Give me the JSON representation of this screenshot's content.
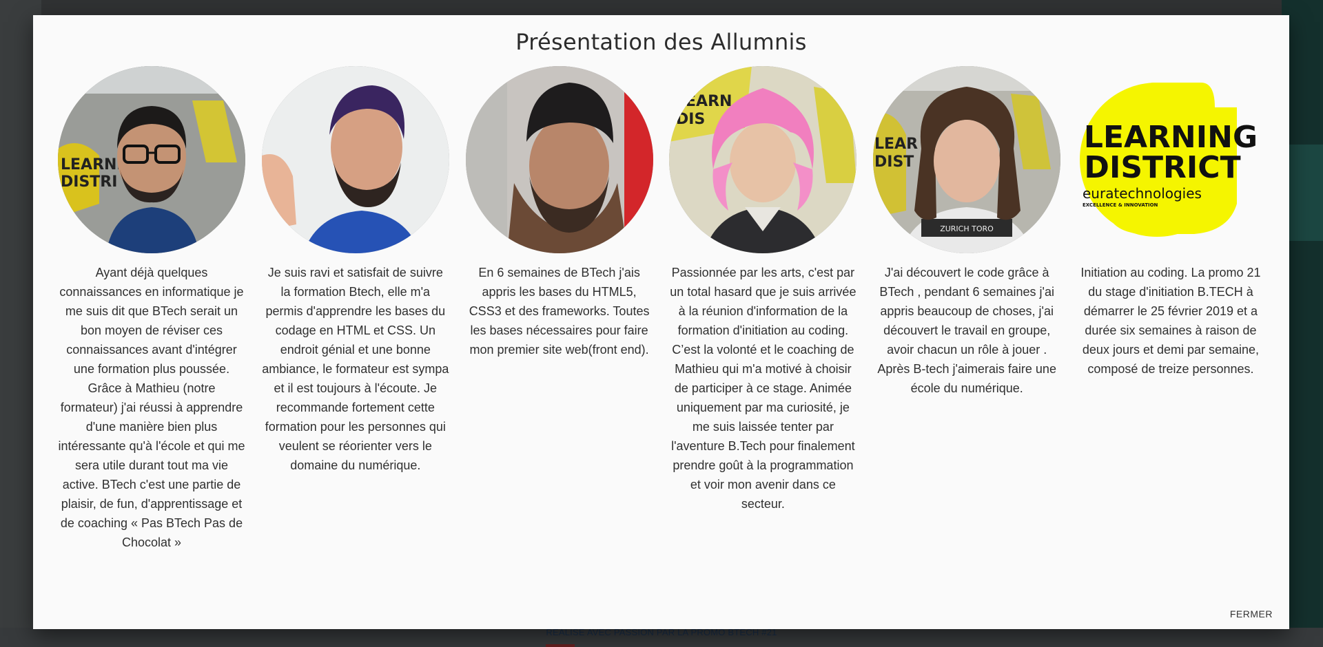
{
  "modal": {
    "title": "Présentation des Allumnis",
    "close_label": "FERMER"
  },
  "alumni": [
    {
      "avatar_alt": "portrait",
      "bio": "Ayant déjà quelques connaissances en informatique je me suis dit que BTech serait un bon moyen de réviser ces connaissances avant d'intégrer une formation plus poussée. Grâce à Mathieu (notre formateur) j'ai réussi à apprendre d'une manière bien plus intéressante qu'à l'école et qui me sera utile durant tout ma vie active. BTech c'est une partie de plaisir, de fun, d'apprentissage et de coaching « Pas BTech Pas de Chocolat »"
    },
    {
      "avatar_alt": "portrait",
      "bio": "Je suis ravi et satisfait de suivre la formation Btech, elle m'a permis d'apprendre les bases du codage en HTML et CSS. Un endroit génial et une bonne ambiance, le formateur est sympa et il est toujours à l'écoute. Je recommande fortement cette formation pour les personnes qui veulent se réorienter vers le domaine du numérique."
    },
    {
      "avatar_alt": "portrait",
      "bio": "En 6 semaines de BTech j'ais appris les bases du HTML5, CSS3 et des frameworks. Toutes les bases nécessaires pour faire mon premier site web(front end)."
    },
    {
      "avatar_alt": "portrait",
      "bio": "Passionnée par les arts, c'est par un total hasard que je suis arrivée à la réunion d'information de la formation d'initiation au coding. C’est la volonté et le coaching de Mathieu qui m'a motivé à choisir de participer à ce stage. Animée uniquement par ma curiosité, je me suis laissée tenter par l'aventure B.Tech pour finalement prendre goût à la programmation et voir mon avenir dans ce secteur."
    },
    {
      "avatar_alt": "portrait",
      "shirt_text": "ZURICH  TORO",
      "bio": "J'ai découvert le code grâce à BTech , pendant 6 semaines j'ai appris beaucoup de choses, j'ai découvert le travail en groupe, avoir chacun un rôle à jouer . Après B-tech j'aimerais faire une école du numérique."
    },
    {
      "avatar_alt": "logo",
      "logo": {
        "line1": "LEARNING",
        "line2": "DISTRICT",
        "brand": "euratechnologies",
        "tagline": "EXCELLENCE & INNOVATION"
      },
      "bio": "Initiation au coding. La promo 21 du stage d'initiation B.TECH à démarrer le 25 février 2019 et a durée six semaines à raison de deux jours et demi par semaine, composé de treize personnes."
    }
  ],
  "background": {
    "footer_text": "RÉALISÉ AVEC PASSION PAR LA PROMO BTECH #21"
  },
  "colors": {
    "logo_yellow": "#f5f500",
    "modal_bg": "#fafafa",
    "text": "#303030"
  }
}
